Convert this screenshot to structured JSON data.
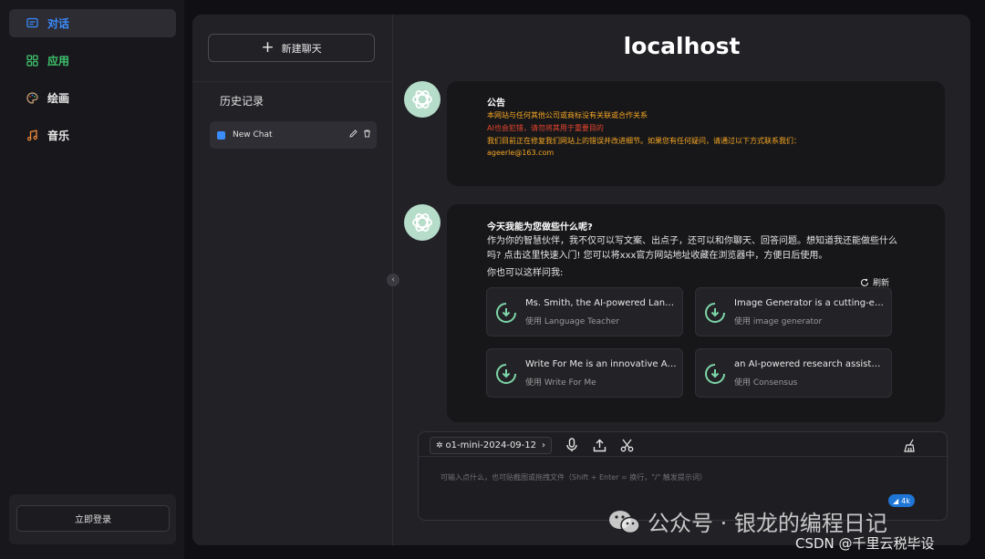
{
  "nav": {
    "items": [
      {
        "label": "对话",
        "icon": "chat-icon"
      },
      {
        "label": "应用",
        "icon": "apps-icon"
      },
      {
        "label": "绘画",
        "icon": "palette-icon"
      },
      {
        "label": "音乐",
        "icon": "music-icon"
      }
    ],
    "login_label": "立即登录"
  },
  "history": {
    "new_chat_label": "新建聊天",
    "title": "历史记录",
    "items": [
      {
        "label": "New Chat"
      }
    ]
  },
  "main": {
    "title": "localhost",
    "announcement": {
      "heading": "公告",
      "lines": [
        "本网站与任何其他公司或商标没有关联或合作关系",
        "AI也会犯错，请勿将其用于重要目的",
        "我们目前正在修复我们网站上的错误并改进细节。如果您有任何疑问，请通过以下方式联系我们：",
        "ageerle@163.com"
      ],
      "colors": [
        "#f5a623",
        "#e8452c",
        "#f5a623",
        "#f5a623"
      ]
    },
    "welcome": {
      "heading": "今天我能为您做些什么呢?",
      "body": "作为你的智慧伙伴，我不仅可以写文案、出点子，还可以和你聊天、回答问题。想知道我还能做些什么吗? 点击这里快速入门! 您可以将xxx官方网站地址收藏在浏览器中，方便日后使用。",
      "hint": "你也可以这样问我:",
      "refresh_label": "刷新",
      "cards": [
        {
          "title": "Ms. Smith, the AI-powered Language Teacher",
          "sub": "使用 Language Teacher"
        },
        {
          "title": "Image Generator is a cutting-edge tool",
          "sub": "使用 image generator"
        },
        {
          "title": "Write For Me is an innovative AI writer",
          "sub": "使用 Write For Me"
        },
        {
          "title": "an AI-powered research assistant",
          "sub": "使用 Consensus"
        }
      ]
    }
  },
  "input": {
    "model": "o1-mini-2024-09-12",
    "placeholder": "可输入点什么，也可贴截图或拖拽文件（Shift + Enter = 换行，\"/\" 触发提示词）",
    "badge": "4k"
  },
  "watermark": {
    "wechat": "公众号 · 银龙的编程日记",
    "csdn": "CSDN @千里云税毕设"
  },
  "colors": {
    "accent": "#3b8cff",
    "green": "#3ec46d",
    "warning": "#f5a623",
    "danger": "#e8452c"
  }
}
